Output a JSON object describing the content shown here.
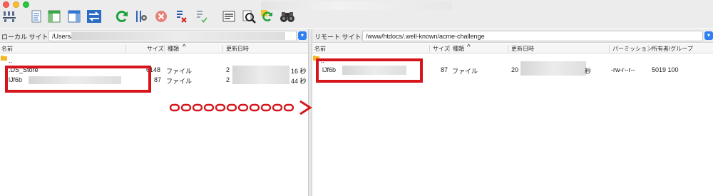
{
  "window": {
    "traffic_lights": [
      "close",
      "minimize",
      "zoom"
    ]
  },
  "toolbar": {
    "buttons": [
      {
        "name": "site-manager-icon"
      },
      {
        "name": "toggle-message-log-icon"
      },
      {
        "name": "toggle-local-tree-icon"
      },
      {
        "name": "toggle-remote-tree-icon"
      },
      {
        "name": "transfer-queue-icon"
      },
      {
        "name": "refresh-icon"
      },
      {
        "name": "process-queue-icon"
      },
      {
        "name": "cancel-operation-icon"
      },
      {
        "name": "disconnect-icon"
      },
      {
        "name": "reconnect-icon"
      },
      {
        "name": "directory-listing-filters-icon"
      },
      {
        "name": "toggle-compare-icon"
      },
      {
        "name": "sync-browsing-icon"
      },
      {
        "name": "search-remote-files-icon"
      }
    ]
  },
  "local": {
    "site_label": "ローカル サイト:",
    "path": "/Users/",
    "columns": {
      "name": "名前",
      "size": "サイズ",
      "type": "種類",
      "modified": "更新日時"
    },
    "rows": [
      {
        "name": "..",
        "size": "",
        "type": "",
        "modified": ""
      },
      {
        "name": ".DS_Store",
        "size": "6148",
        "type": "ファイル",
        "modified_prefix": "2",
        "modified_suffix": "16 秒"
      },
      {
        "name": "lJf6b",
        "size": "87",
        "type": "ファイル",
        "modified_prefix": "2",
        "modified_suffix": "44 秒"
      }
    ]
  },
  "remote": {
    "site_label": "リモート サイト:",
    "path": "/www/htdocs/.well-known/acme-challenge",
    "columns": {
      "name": "名前",
      "size": "サイズ",
      "type": "種類",
      "modified": "更新日時",
      "permission": "パーミッション",
      "owner": "所有者/グループ"
    },
    "rows": [
      {
        "name": "..",
        "size": "",
        "type": "",
        "modified": "",
        "permission": "",
        "owner": ""
      },
      {
        "name": "lJf6b",
        "size": "87",
        "type": "ファイル",
        "modified_prefix": "20",
        "modified_suffix": "秒",
        "permission": "-rw-r--r--",
        "owner": "5019 100"
      }
    ]
  },
  "annotation": {
    "color": "#d5141b",
    "arrow_glyph": ">"
  }
}
